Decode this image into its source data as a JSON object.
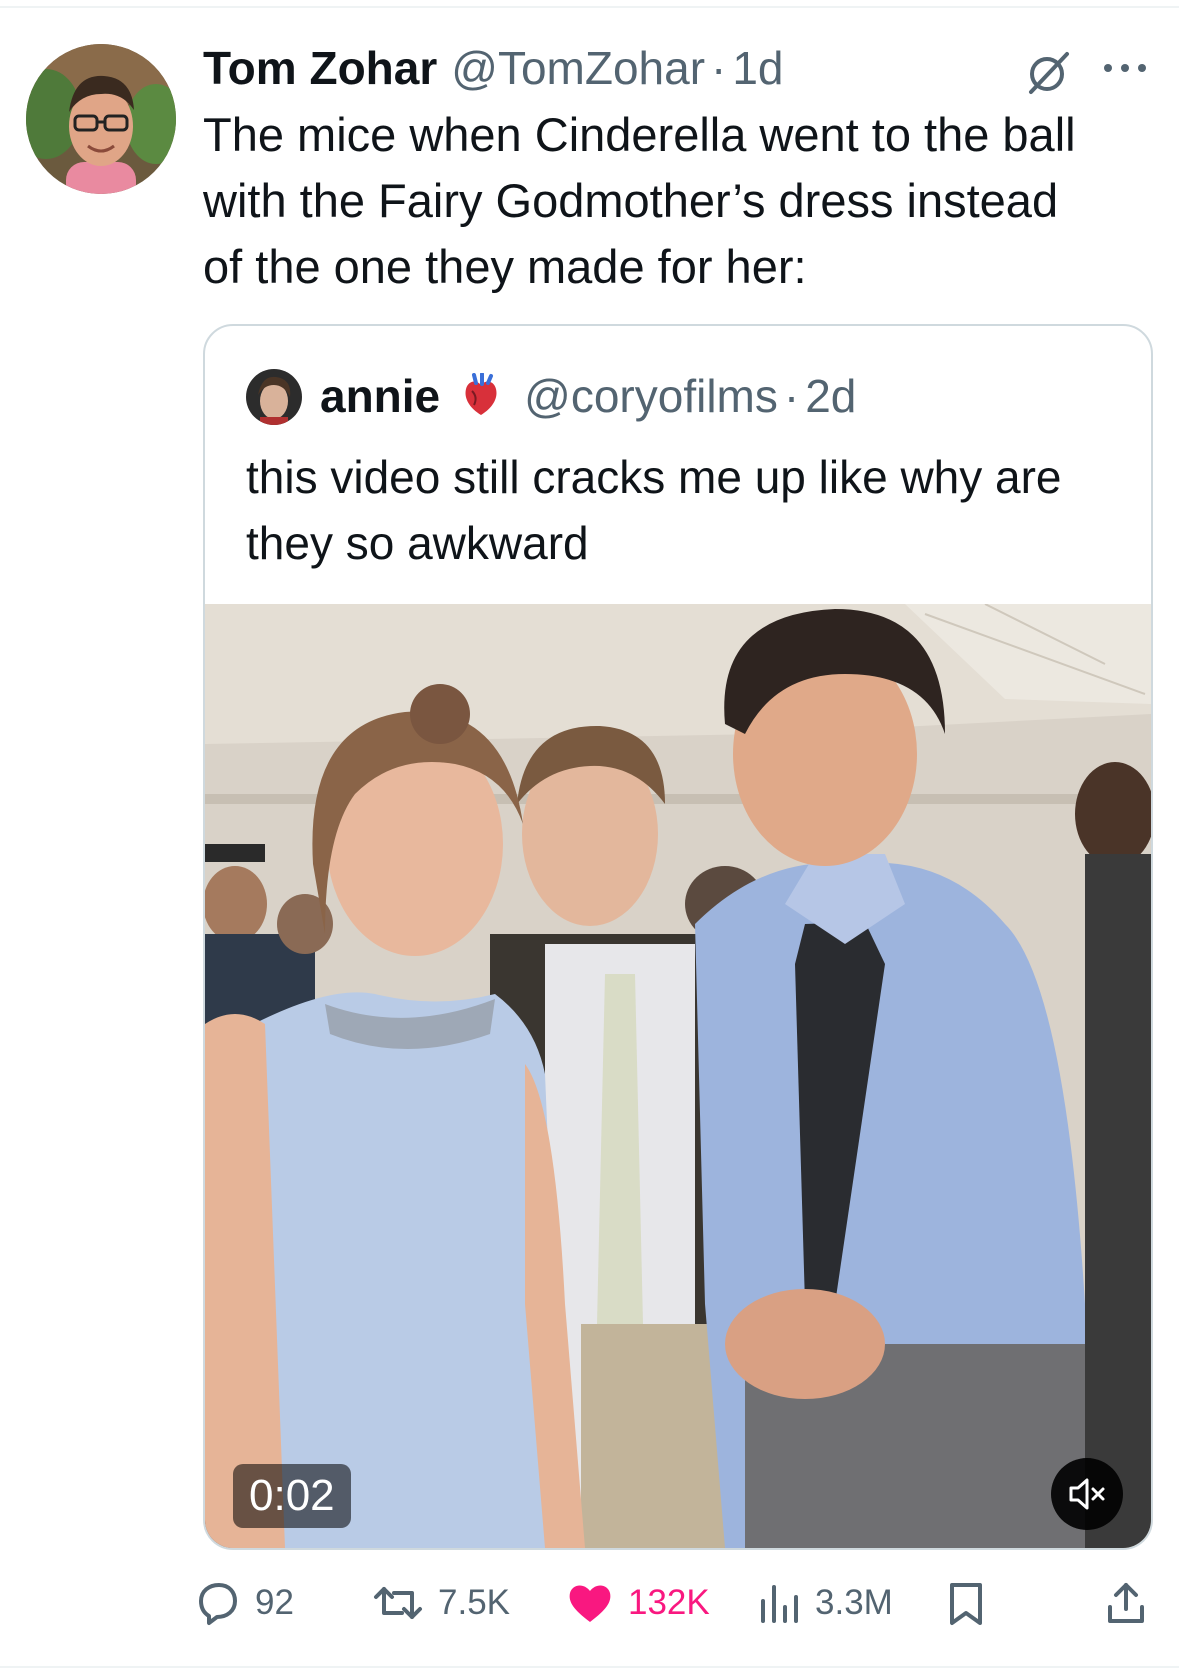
{
  "tweet": {
    "author_name": "Tom Zohar",
    "author_handle": "@TomZohar",
    "separator": "·",
    "time": "1d",
    "text": "The mice when Cinderella went to the ball with the Fairy Godmother’s dress instead of the one they made for her:",
    "icons": [
      "grok-icon",
      "more-icon"
    ]
  },
  "quote": {
    "author_name": "annie",
    "emoji": "anatomical-heart-emoji",
    "author_handle": "@coryofilms",
    "separator": "·",
    "time": "2d",
    "text": "this video still cracks me up like why are they so awkward",
    "video": {
      "timestamp": "0:02",
      "muted": true
    }
  },
  "actions": {
    "replies": "92",
    "reposts": "7.5K",
    "likes": "132K",
    "views": "3.3M",
    "liked": true
  },
  "colors": {
    "text": "#0f1419",
    "secondary": "#536471",
    "like": "#f91880",
    "border": "#cfd9de"
  }
}
